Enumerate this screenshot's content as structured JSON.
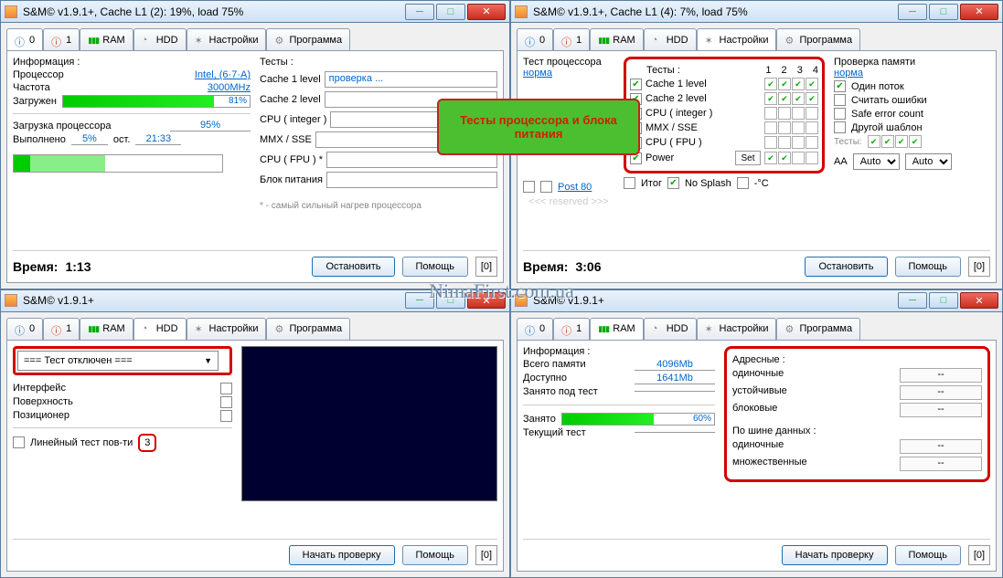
{
  "watermark": "NimaFirst.com.ua",
  "callout": "Тесты процессора и блока питания",
  "w1": {
    "title": "S&M© v1.9.1+, Cache L1 (2): 19%, load 75%",
    "tabs": [
      "0",
      "1",
      "RAM",
      "HDD",
      "Настройки",
      "Программа"
    ],
    "info_hdr": "Информация :",
    "tests_hdr": "Тесты :",
    "proc_lbl": "Процессор",
    "proc_val": "Intel, (6·7·A)",
    "freq_lbl": "Частота",
    "freq_val": "3000MHz",
    "load_lbl": "Загружен",
    "load_pct": "81%",
    "cpu_load_lbl": "Загрузка  процессора",
    "cpu_load_pct": "95%",
    "done_lbl": "Выполнено",
    "done_pct": "5%",
    "ost_lbl": "ост.",
    "ost_val": "21:33",
    "tests": [
      "Cache 1 level",
      "Cache 2 level",
      "CPU ( integer )",
      "MMX / SSE",
      "CPU ( FPU ) *",
      "Блок питания"
    ],
    "test_running": "проверка ...",
    "note": "* - самый сильный нагрев процессора",
    "time_lbl": "Время:",
    "time_val": "1:13",
    "btn_stop": "Остановить",
    "btn_help": "Помощь",
    "btn0": "[0]"
  },
  "w2": {
    "title": "S&M© v1.9.1+, Cache L1 (4): 7%, load 75%",
    "tabs": [
      "0",
      "1",
      "RAM",
      "HDD",
      "Настройки",
      "Программа"
    ],
    "cpu_test_lbl": "Тест процессора",
    "cpu_test_val": "норма",
    "tests_hdr": "Тесты :",
    "cols_hdr": [
      "1",
      "2",
      "3",
      "4"
    ],
    "memcheck_lbl": "Проверка памяти",
    "memcheck_val": "норма",
    "tests": [
      {
        "name": "Cache 1 level",
        "on": true,
        "cells": [
          true,
          true,
          true,
          true
        ]
      },
      {
        "name": "Cache 2 level",
        "on": true,
        "cells": [
          true,
          true,
          true,
          true
        ]
      },
      {
        "name": "CPU ( integer )",
        "on": false,
        "cells": [
          false,
          false,
          false,
          false
        ]
      },
      {
        "name": "MMX / SSE",
        "on": false,
        "cells": [
          false,
          false,
          false,
          false
        ]
      },
      {
        "name": "CPU ( FPU )",
        "on": true,
        "cells": [
          false,
          false,
          false,
          false
        ]
      },
      {
        "name": "Power",
        "on": true,
        "cells": [
          true,
          true,
          false,
          false
        ],
        "set": "Set"
      }
    ],
    "post80": "Post 80",
    "reserved": "<<<  reserved  >>>",
    "itog": "Итог",
    "nosplash": "No Splash",
    "degc": "-°C",
    "aa": "AA",
    "auto": "Auto",
    "one_thread": "Один поток",
    "count_err": "Считать ошибки",
    "safe_err": "Safe error count",
    "other_tpl": "Другой шаблон",
    "tests_mini": "Тесты:",
    "time_lbl": "Время:",
    "time_val": "3:06",
    "btn_stop": "Остановить",
    "btn_help": "Помощь",
    "btn0": "[0]"
  },
  "w3": {
    "title": "S&M© v1.9.1+",
    "tabs": [
      "0",
      "1",
      "RAM",
      "HDD",
      "Настройки",
      "Программа"
    ],
    "dd": "=== Тест отключен ===",
    "iface": "Интерфейс",
    "surface": "Поверхность",
    "positioner": "Позиционер",
    "linear": "Линейный тест пов-ти",
    "linear_n": "3",
    "btn_start": "Начать проверку",
    "btn_help": "Помощь",
    "btn0": "[0]"
  },
  "w4": {
    "title": "S&M© v1.9.1+",
    "tabs": [
      "0",
      "1",
      "RAM",
      "HDD",
      "Настройки",
      "Программа"
    ],
    "info_hdr": "Информация :",
    "total_lbl": "Всего памяти",
    "total_val": "4096Mb",
    "avail_lbl": "Доступно",
    "avail_val": "1641Mb",
    "under_lbl": "Занято под тест",
    "under_val": "",
    "busy_lbl": "Занято",
    "busy_pct": "60%",
    "cur_lbl": "Текущий тест",
    "addr_hdr": "Адресные :",
    "addr": [
      {
        "l": "одиночные",
        "v": "--"
      },
      {
        "l": "устойчивые",
        "v": "--"
      },
      {
        "l": "блоковые",
        "v": "--"
      }
    ],
    "bus_hdr": "По шине данных :",
    "bus": [
      {
        "l": "одиночные",
        "v": "--"
      },
      {
        "l": "множественные",
        "v": "--"
      }
    ],
    "btn_start": "Начать проверку",
    "btn_help": "Помощь",
    "btn0": "[0]"
  }
}
